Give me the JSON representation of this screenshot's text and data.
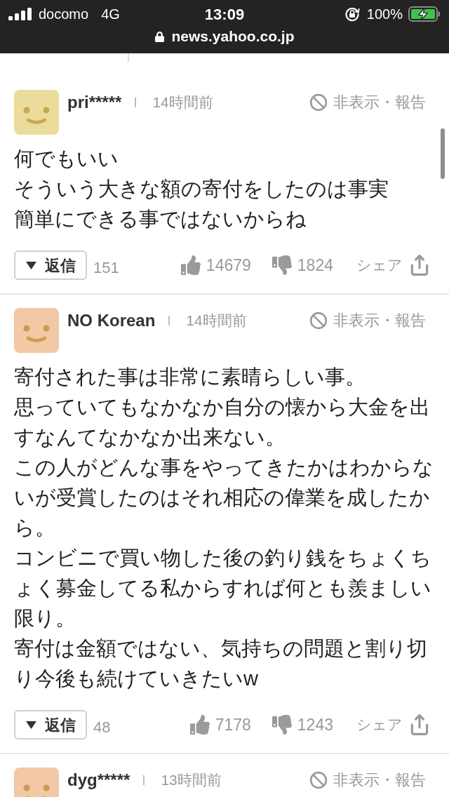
{
  "status_bar": {
    "carrier": "docomo",
    "network": "4G",
    "time": "13:09",
    "battery": "100%",
    "charging": true
  },
  "address_bar": {
    "url": "news.yahoo.co.jp"
  },
  "comments": [
    {
      "user": "pri*****",
      "time": "14時間前",
      "action": "非表示・報告",
      "color": "#ecdc9c",
      "paragraphs": [
        "何でもいい",
        "そういう大きな額の寄付をしたのは事実",
        "簡単にできる事ではないからね"
      ],
      "reply": "返信",
      "replies": "151",
      "likes": "14679",
      "dislikes": "1824",
      "share": "シェア"
    },
    {
      "user": "NO Korean",
      "time": "14時間前",
      "action": "非表示・報告",
      "color": "#f2c8a5",
      "paragraphs": [
        "寄付された事は非常に素晴らしい事。",
        "思っていてもなかなか自分の懐から大金を出すなんてなかなか出来ない。",
        "この人がどんな事をやってきたかはわからないが受賞したのはそれ相応の偉業を成したから。",
        "コンビニで買い物した後の釣り銭をちょくちょく募金してる私からすれば何とも羨ましい限り。",
        "寄付は金額ではない、気持ちの問題と割り切り今後も続けていきたいw"
      ],
      "reply": "返信",
      "replies": "48",
      "likes": "7178",
      "dislikes": "1243",
      "share": "シェア"
    },
    {
      "user": "dyg*****",
      "time": "13時間前",
      "action": "非表示・報告",
      "color": "#f2c8a5"
    }
  ]
}
